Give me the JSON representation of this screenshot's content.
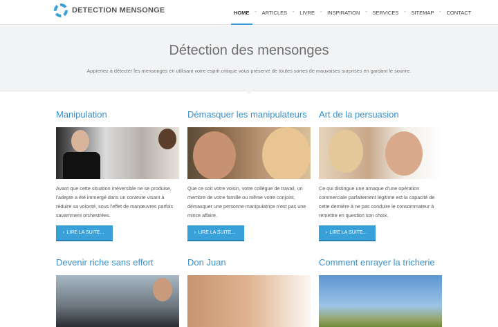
{
  "brand": {
    "name": "DETECTION MENSONGE",
    "accent": "#3aa0d8"
  },
  "nav": {
    "items": [
      "HOME",
      "ARTICLES",
      "LIVRE",
      "INSPIRATION",
      "SERVICES",
      "SITEMAP",
      "CONTACT"
    ],
    "active": "HOME"
  },
  "hero": {
    "title": "Détection des mensonges",
    "subtitle": "Apprenez à détecter les mensonges en utilisant votre esprit critique vous préserve de toutes sortes de mauvaises surprises en gardant le sourire."
  },
  "cards": [
    {
      "title": "Manipulation",
      "text": "Avant que cette situation irréversible ne se produise, l'adepte a été immergé dans un contexte visant à réduire sa volonté, sous l'effet de manœuvres parfois savamment orchestrées.",
      "button": "LIRE LA SUITE..."
    },
    {
      "title": "Démasquer les manipulateurs",
      "text": "Que ce soit votre voisin, votre collègue de travail, un membre de votre famille ou même votre conjoint, démasquer une personne manipulatrice n'est pas une mince affaire.",
      "button": "LIRE LA SUITE..."
    },
    {
      "title": "Art de la persuasion",
      "text": "Ce qui distingue une arnaque d'une opération commerciale parfaitement légitime est la capacité de cette dernière à ne pas conduire le consommateur à remettre en question son choix.",
      "button": "LIRE LA SUITE..."
    },
    {
      "title": "Devenir riche sans effort"
    },
    {
      "title": "Don Juan"
    },
    {
      "title": "Comment enrayer la tricherie"
    }
  ]
}
